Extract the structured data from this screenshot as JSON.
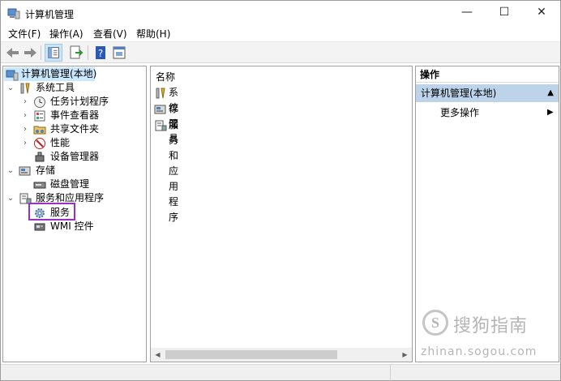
{
  "window": {
    "title": "计算机管理",
    "controls": {
      "minimize": "—",
      "maximize": "☐",
      "close": "✕"
    }
  },
  "menu": [
    "文件(F)",
    "操作(A)",
    "查看(V)",
    "帮助(H)"
  ],
  "toolbar": {
    "buttons": [
      "back-arrow",
      "forward-arrow",
      "show-hide-tree",
      "export-list",
      "help",
      "properties"
    ]
  },
  "tree": {
    "root": "计算机管理(本地)",
    "system_tools": "系统工具",
    "task_scheduler": "任务计划程序",
    "event_viewer": "事件查看器",
    "shared_folders": "共享文件夹",
    "performance": "性能",
    "device_manager": "设备管理器",
    "storage": "存储",
    "disk_management": "磁盘管理",
    "services_apps": "服务和应用程序",
    "services": "服务",
    "wmi": "WMI 控件"
  },
  "content": {
    "column_header": "名称",
    "rows": [
      "系统工具",
      "存储",
      "服务和应用程序"
    ]
  },
  "actions": {
    "header": "操作",
    "section": "计算机管理(本地)",
    "more": "更多操作"
  },
  "watermark": {
    "logo": "S",
    "text": "搜狗指南",
    "url": "zhinan.sogou.com"
  },
  "colors": {
    "selection": "#cce8ff",
    "action_section": "#bcd3ea",
    "highlight_box": "#9b30c9"
  }
}
